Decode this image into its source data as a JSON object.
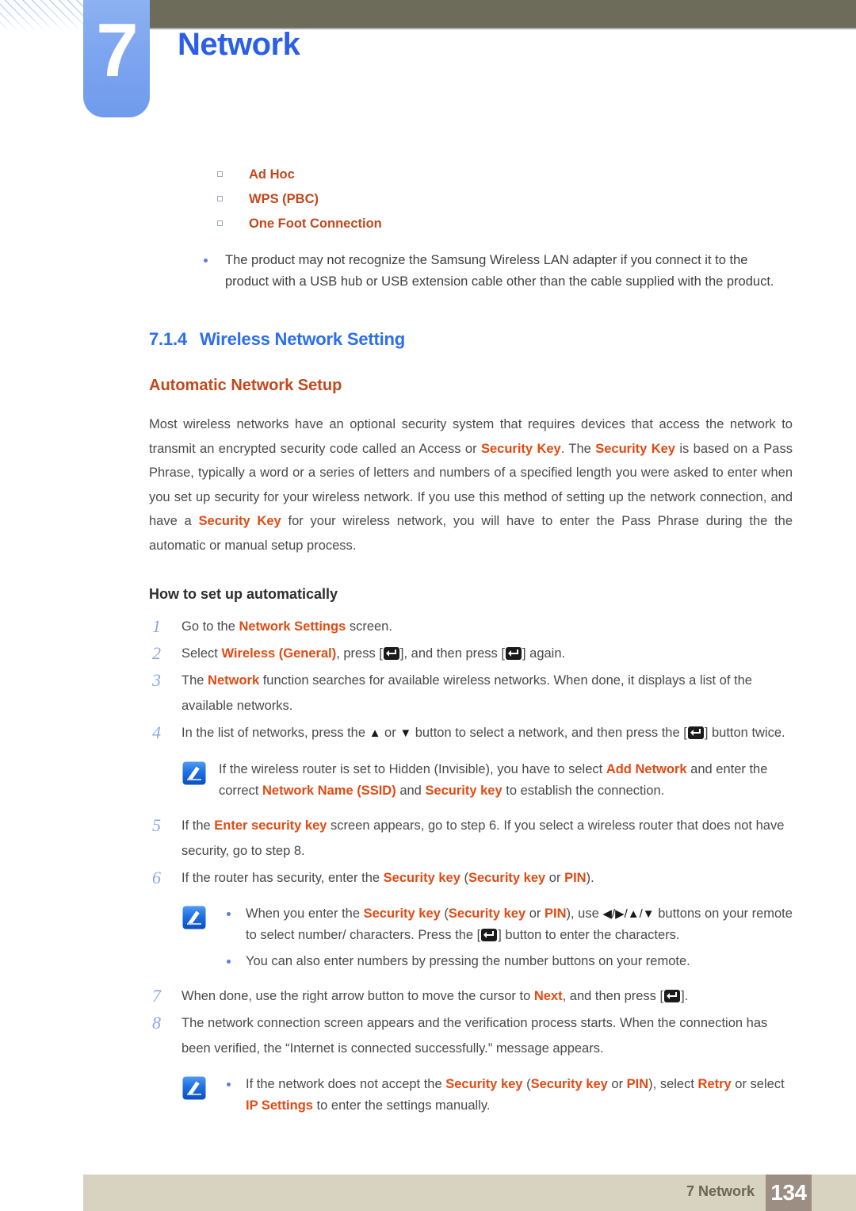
{
  "header": {
    "chapter_number": "7",
    "chapter_title": "Network"
  },
  "intro": {
    "modes": [
      {
        "label": "Ad Hoc"
      },
      {
        "label": "WPS (PBC)"
      },
      {
        "label": "One Foot Connection"
      }
    ],
    "note_bullet": {
      "text_1": "The product may not recognize the Samsung Wireless LAN adapter if you connect it to the product with a USB hub or USB extension cable other than the cable supplied with the product."
    }
  },
  "section": {
    "number": "7.1.4",
    "title": "Wireless Network Setting",
    "subtitle": "Automatic Network Setup",
    "paragraph": {
      "p1": "Most wireless networks have an optional security system that requires devices that access the network to transmit an encrypted security code called an Access or ",
      "k1": "Security Key",
      "p2": ". The ",
      "k2": "Security Key",
      "p3": " is based on a Pass Phrase, typically a word or a series of letters and numbers of a specified length you were asked to enter when you set up security for your wireless network. If you use this method of setting up the network connection, and have a ",
      "k3": "Security Key",
      "p4": " for your wireless network, you will have to enter the Pass Phrase during the the automatic or manual setup process."
    },
    "how_to_title": "How to set up automatically"
  },
  "steps": [
    {
      "num": "1",
      "parts": [
        {
          "t": "Go to the "
        },
        {
          "t": "Network Settings",
          "em": true
        },
        {
          "t": " screen."
        }
      ]
    },
    {
      "num": "2",
      "parts": [
        {
          "t": "Select "
        },
        {
          "t": "Wireless (General)",
          "em": true
        },
        {
          "t": ", press ["
        },
        {
          "t": "",
          "key": "enter-key"
        },
        {
          "t": "], and then press ["
        },
        {
          "t": "",
          "key": "enter-key"
        },
        {
          "t": "] again."
        }
      ]
    },
    {
      "num": "3",
      "parts": [
        {
          "t": "The "
        },
        {
          "t": "Network",
          "em": true
        },
        {
          "t": " function searches for available wireless networks. When done, it displays a list of the available networks."
        }
      ]
    },
    {
      "num": "4",
      "parts": [
        {
          "t": "In the list of networks, press the "
        },
        {
          "t": "▲",
          "glyph": true
        },
        {
          "t": " or "
        },
        {
          "t": "▼",
          "glyph": true
        },
        {
          "t": " button to select a network, and then press the ["
        },
        {
          "t": "",
          "key": "enter-key"
        },
        {
          "t": "] button twice."
        }
      ]
    },
    {
      "num": "5",
      "parts": [
        {
          "t": "If the "
        },
        {
          "t": "Enter security key",
          "em": true
        },
        {
          "t": " screen appears, go to step 6. If you select a wireless router that does not have security, go to step 8."
        }
      ]
    },
    {
      "num": "6",
      "parts": [
        {
          "t": "If the router has security, enter the "
        },
        {
          "t": "Security key",
          "em": true
        },
        {
          "t": " ("
        },
        {
          "t": "Security key",
          "em": true
        },
        {
          "t": " or "
        },
        {
          "t": "PIN",
          "em": true
        },
        {
          "t": ")."
        }
      ]
    },
    {
      "num": "7",
      "parts": [
        {
          "t": "When done, use the right arrow button to move the cursor to "
        },
        {
          "t": "Next",
          "em": true
        },
        {
          "t": ", and then press ["
        },
        {
          "t": "",
          "key": "enter-key"
        },
        {
          "t": "]."
        }
      ]
    },
    {
      "num": "8",
      "parts": [
        {
          "t": "The network connection screen appears and the verification process starts. When the connection has been verified, the “Internet is connected successfully.” message appears."
        }
      ]
    }
  ],
  "notes": {
    "note_1": {
      "icon": "note-pencil-icon",
      "parts": [
        {
          "t": "If the wireless router is set to Hidden (Invisible), you have to select "
        },
        {
          "t": "Add Network",
          "em": true
        },
        {
          "t": " and enter the correct "
        },
        {
          "t": "Network Name (SSID)",
          "em": true
        },
        {
          "t": " and "
        },
        {
          "t": "Security key",
          "em": true
        },
        {
          "t": " to establish the connection."
        }
      ]
    },
    "note_2": {
      "icon": "note-pencil-icon",
      "bullets": [
        {
          "parts": [
            {
              "t": "When you enter the "
            },
            {
              "t": "Security key",
              "em": true
            },
            {
              "t": " ("
            },
            {
              "t": "Security key",
              "em": true
            },
            {
              "t": " or "
            },
            {
              "t": "PIN",
              "em": true
            },
            {
              "t": "), use "
            },
            {
              "t": "◀/▶/▲/▼",
              "glyph": true
            },
            {
              "t": " buttons on your remote to select number/ characters. Press the ["
            },
            {
              "t": "",
              "key": "enter-key"
            },
            {
              "t": "] button to enter the characters."
            }
          ]
        },
        {
          "parts": [
            {
              "t": "You can also enter numbers by pressing the number buttons on your remote."
            }
          ]
        }
      ]
    },
    "note_3": {
      "icon": "note-pencil-icon",
      "bullets": [
        {
          "parts": [
            {
              "t": "If the network does not accept the "
            },
            {
              "t": "Security key",
              "em": true
            },
            {
              "t": " ("
            },
            {
              "t": "Security key",
              "em": true
            },
            {
              "t": " or "
            },
            {
              "t": "PIN",
              "em": true
            },
            {
              "t": "), select "
            },
            {
              "t": "Retry",
              "em": true
            },
            {
              "t": " or select "
            },
            {
              "t": "IP Settings",
              "em": true
            },
            {
              "t": " to enter the settings manually."
            }
          ]
        }
      ]
    }
  },
  "footer": {
    "label": "7 Network",
    "page_number": "134"
  },
  "colors": {
    "accent_blue": "#2b6ef0",
    "accent_orange": "#e24a12",
    "heading_orange": "#c4471b",
    "olive_bar": "#6d6b59",
    "tab_blue": "#7fa6ef",
    "footer_bar": "#d8d3c0",
    "footer_page_box": "#9c8e83"
  }
}
